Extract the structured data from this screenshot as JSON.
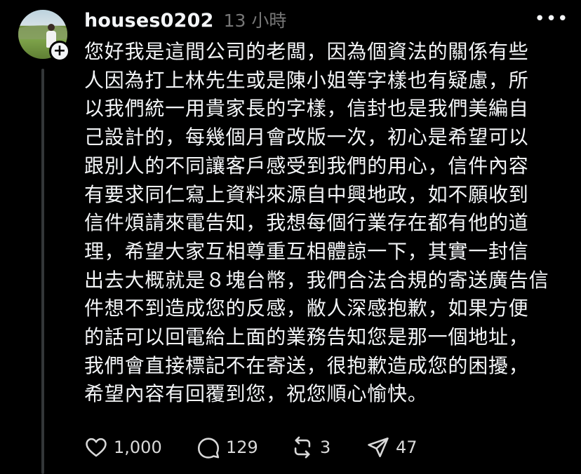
{
  "post": {
    "username": "houses0202",
    "timestamp": "13 小時",
    "more_icon": "more-horizontal-icon",
    "follow_icon": "plus-icon",
    "body_lines": [
      "您好我是這間公司的老闆，因為個資法的關係有些",
      "人因為打上林先生或是陳小姐等字樣也有疑慮，所",
      "以我們統一用貴家長的字樣，信封也是我們美編自",
      "己設計的，每幾個月會改版一次，初心是希望可以",
      "跟別人的不同讓客戶感受到我們的用心，信件內容",
      "有要求同仁寫上資料來源自中興地政，如不願收到",
      "信件煩請來電告知，我想每個行業存在都有他的道",
      "理，希望大家互相尊重互相體諒一下，其實一封信",
      "出去大概就是８塊台幣，我們合法合規的寄送廣告信",
      "件想不到造成您的反感，敝人深感抱歉，如果方便",
      "的話可以回電給上面的業務告知您是那一個地址，",
      "我們會直接標記不在寄送，很抱歉造成您的困擾，",
      "希望內容有回覆到您，祝您順心愉快。"
    ],
    "actions": {
      "likes": "1,000",
      "replies": "129",
      "reposts": "3",
      "shares": "47"
    }
  }
}
